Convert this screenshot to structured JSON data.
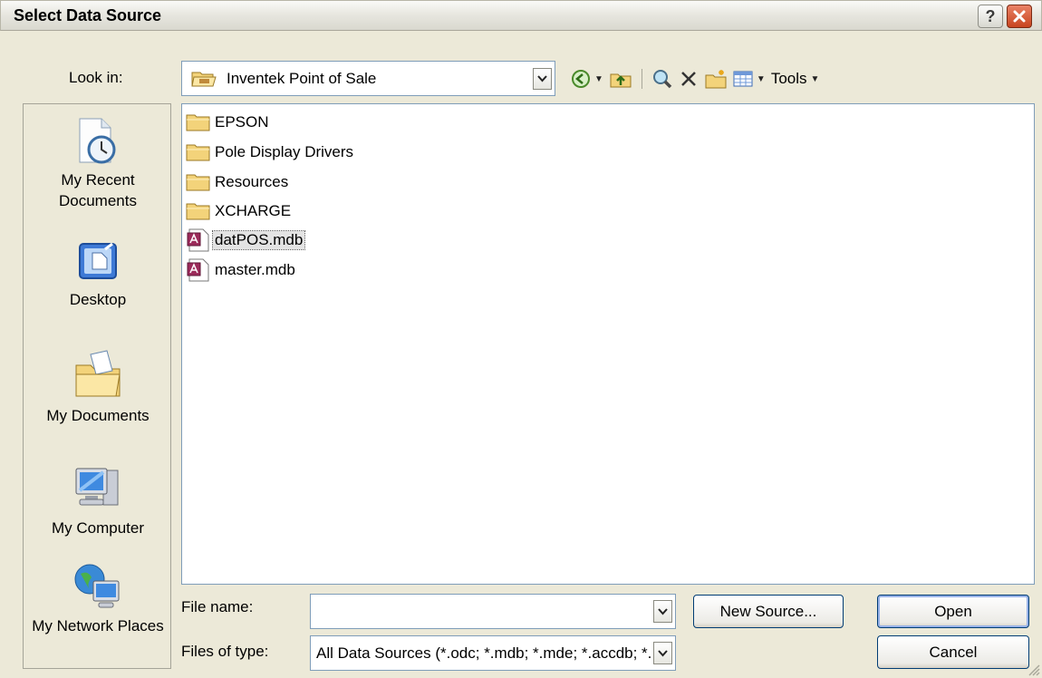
{
  "window": {
    "title": "Select Data Source",
    "help_glyph": "?"
  },
  "lookin": {
    "label": "Look in:",
    "value": "Inventek Point of Sale",
    "tools_label": "Tools"
  },
  "places": [
    {
      "label": "My Recent Documents",
      "icon": "recent-documents-icon"
    },
    {
      "label": "Desktop",
      "icon": "desktop-icon"
    },
    {
      "label": "My Documents",
      "icon": "my-documents-icon"
    },
    {
      "label": "My Computer",
      "icon": "my-computer-icon"
    },
    {
      "label": "My Network Places",
      "icon": "network-places-icon"
    }
  ],
  "files": [
    {
      "name": "EPSON",
      "type": "folder"
    },
    {
      "name": "Pole Display Drivers",
      "type": "folder"
    },
    {
      "name": "Resources",
      "type": "folder"
    },
    {
      "name": "XCHARGE",
      "type": "folder"
    },
    {
      "name": "datPOS.mdb",
      "type": "access-db",
      "selected": true
    },
    {
      "name": "master.mdb",
      "type": "access-db"
    }
  ],
  "filename": {
    "label": "File name:",
    "value": ""
  },
  "filetype": {
    "label": "Files of type:",
    "value": "All Data Sources (*.odc; *.mdb; *.mde; *.accdb; *.accde; *.ade; *.adp; *.udl; *.dsn)"
  },
  "buttons": {
    "new_source": "New Source...",
    "open": "Open",
    "cancel": "Cancel"
  },
  "colors": {
    "dialog_bg": "#ece9d8",
    "field_border": "#7f9db9",
    "close_button": "#c8441f"
  }
}
